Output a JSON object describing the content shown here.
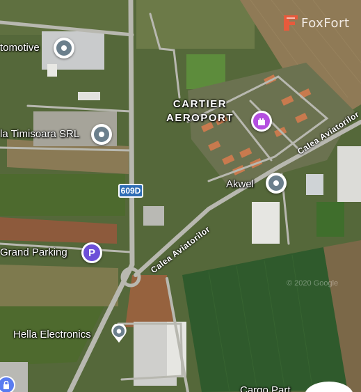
{
  "map": {
    "district_label_line1": "CARTIER",
    "district_label_line2": "AEROPORT",
    "road_badge": "609D",
    "streets": {
      "calea_aviatorilor_1": "Calea Aviatorilor",
      "calea_aviatorilor_2": "Calea Aviatorilor"
    },
    "places": [
      {
        "name": "tomotive",
        "icon": "pin-icon"
      },
      {
        "name": "la Timisoara SRL",
        "icon": "pin-icon"
      },
      {
        "name": "Akwel",
        "icon": "pin-icon"
      },
      {
        "name": "Grand Parking",
        "icon": "parking-icon"
      },
      {
        "name": "Hella Electronics",
        "icon": "pin-icon"
      },
      {
        "name": "Cargo Part",
        "icon": "pin-icon"
      }
    ],
    "landmark_icon": "castle-icon",
    "watermark": "© 2020 Google"
  },
  "brand": {
    "name": "FoxFort",
    "logo_color": "#e85a3c"
  },
  "colors": {
    "road": "#b8b8b0",
    "field_green": "#4f6a2e",
    "field_brown": "#8a7a55",
    "poi_pin": "#6b7f8c",
    "parking": "#6c4fd8",
    "landmark": "#b44fe0",
    "shield_blue": "#2f6db5"
  }
}
